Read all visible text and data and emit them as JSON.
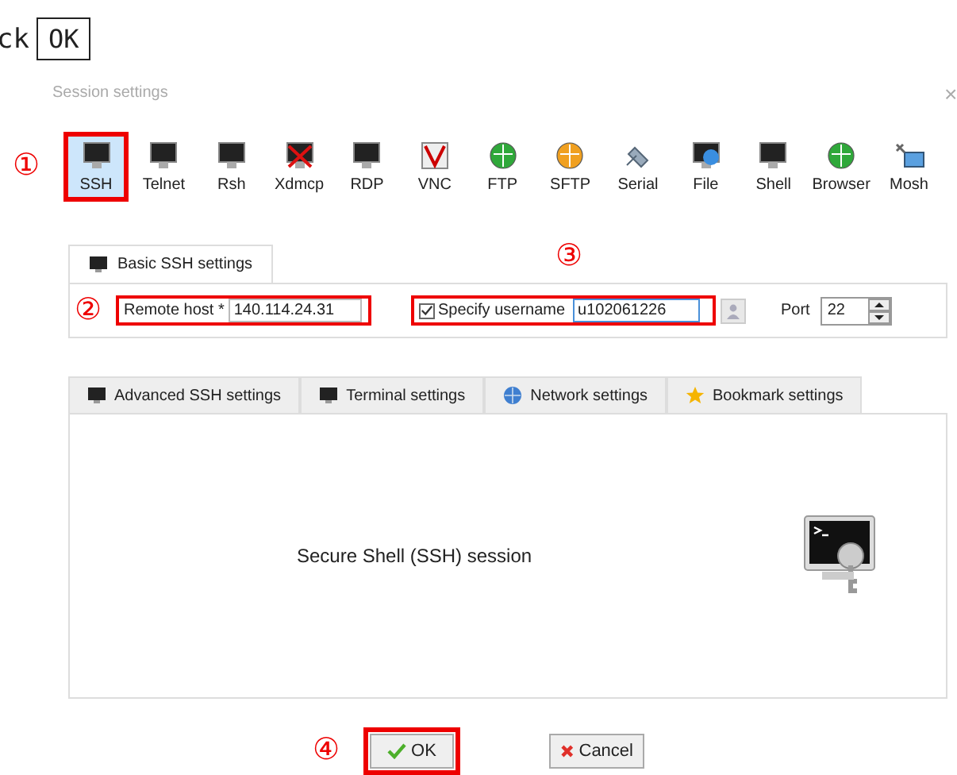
{
  "instruction": {
    "text": "ck",
    "button": "OK"
  },
  "window": {
    "title": "Session settings",
    "close": "×"
  },
  "session_types": [
    {
      "label": "SSH",
      "selected": true
    },
    {
      "label": "Telnet",
      "selected": false
    },
    {
      "label": "Rsh",
      "selected": false
    },
    {
      "label": "Xdmcp",
      "selected": false
    },
    {
      "label": "RDP",
      "selected": false
    },
    {
      "label": "VNC",
      "selected": false
    },
    {
      "label": "FTP",
      "selected": false
    },
    {
      "label": "SFTP",
      "selected": false
    },
    {
      "label": "Serial",
      "selected": false
    },
    {
      "label": "File",
      "selected": false
    },
    {
      "label": "Shell",
      "selected": false
    },
    {
      "label": "Browser",
      "selected": false
    },
    {
      "label": "Mosh",
      "selected": false
    }
  ],
  "basic_tab": {
    "label": "Basic SSH settings"
  },
  "remote_host": {
    "label": "Remote host *",
    "value": "140.114.24.31"
  },
  "username": {
    "label": "Specify username",
    "checked": true,
    "value": "u102061226"
  },
  "port": {
    "label": "Port",
    "value": "22"
  },
  "sub_tabs": [
    {
      "label": "Advanced SSH settings"
    },
    {
      "label": "Terminal settings"
    },
    {
      "label": "Network settings"
    },
    {
      "label": "Bookmark settings"
    }
  ],
  "description": "Secure Shell (SSH) session",
  "buttons": [
    {
      "kind": "ok",
      "label": "OK"
    },
    {
      "kind": "cancel",
      "label": "Cancel"
    }
  ],
  "callouts": [
    "①",
    "②",
    "③",
    "④"
  ]
}
